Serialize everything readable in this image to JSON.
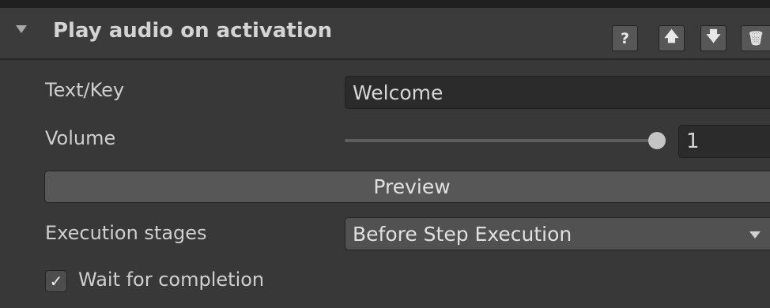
{
  "component": {
    "title": "Play audio on activation",
    "header_buttons": {
      "help_label": "?",
      "move_up_label": "🡅",
      "move_down_label": "🡇",
      "delete_label": "🗑"
    }
  },
  "fields": {
    "text_key": {
      "label": "Text/Key",
      "value": "Welcome"
    },
    "volume": {
      "label": "Volume",
      "value": "1",
      "slider_fraction": 1.0
    },
    "preview_button_label": "Preview",
    "execution_stages": {
      "label": "Execution stages",
      "selected": "Before Step Execution"
    },
    "wait_for_completion": {
      "label": "Wait for completion",
      "checked": true
    }
  }
}
